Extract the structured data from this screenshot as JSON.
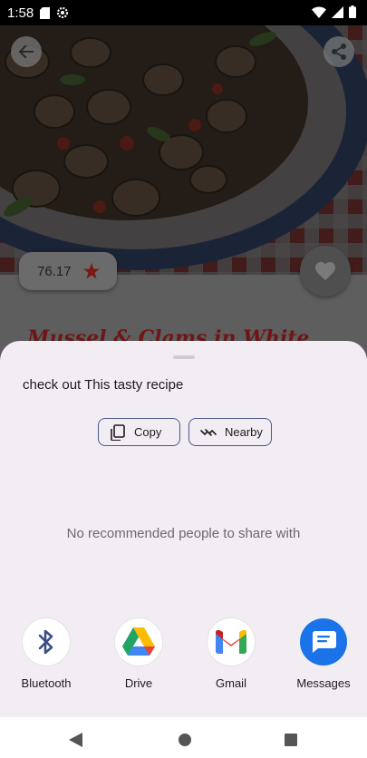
{
  "status_bar": {
    "time": "1:58"
  },
  "recipe": {
    "rating": "76.17",
    "title_peek": "Mussel & Clams in White"
  },
  "share_sheet": {
    "shared_text": "check out This tasty recipe",
    "copy_label": "Copy",
    "nearby_label": "Nearby",
    "empty_message": "No recommended people to share with",
    "apps": [
      {
        "label": "Bluetooth",
        "icon": "bluetooth-icon"
      },
      {
        "label": "Drive",
        "icon": "drive-icon"
      },
      {
        "label": "Gmail",
        "icon": "gmail-icon"
      },
      {
        "label": "Messages",
        "icon": "messages-icon"
      }
    ]
  },
  "colors": {
    "sheet_bg": "#f1edf3",
    "chip_border": "#4a5a8f",
    "rating_star": "#b3261e",
    "messages_blue": "#1a73e8"
  }
}
